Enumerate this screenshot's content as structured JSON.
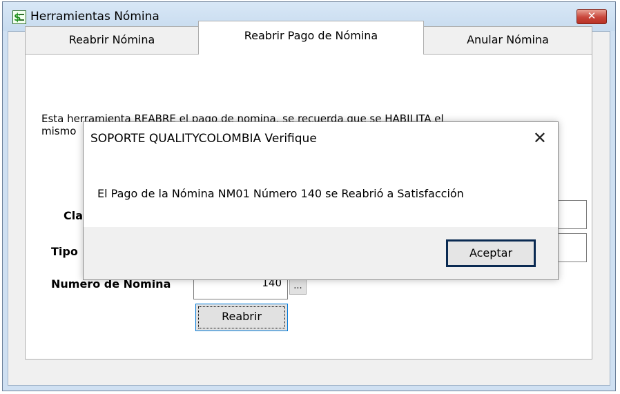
{
  "window": {
    "title": "Herramientas Nómina",
    "icon": "payroll-dollar-icon",
    "close_glyph": "✕"
  },
  "tabs": [
    {
      "label": "Reabrir Nómina",
      "active": false
    },
    {
      "label": "Reabrir Pago de Nómina",
      "active": true
    },
    {
      "label": "Anular Nómina",
      "active": false
    }
  ],
  "panel": {
    "description_line1": "Esta herramienta REABRE el pago de nomina, se recuerda que se HABILITA el",
    "description_line2": "mismo",
    "clase_label": "Cla",
    "tipo_label": "Tipo",
    "numero_label": "Numero de Nomina",
    "numero_value": "140",
    "lookup_label": "...",
    "reabrir_button": "Reabrir"
  },
  "dialog": {
    "title": "SOPORTE QUALITYCOLOMBIA Verifique",
    "close_glyph": "✕",
    "message": "El Pago de la Nómina NM01 Número 140 se Reabrió a Satisfacción",
    "ok_button": "Aceptar"
  }
}
